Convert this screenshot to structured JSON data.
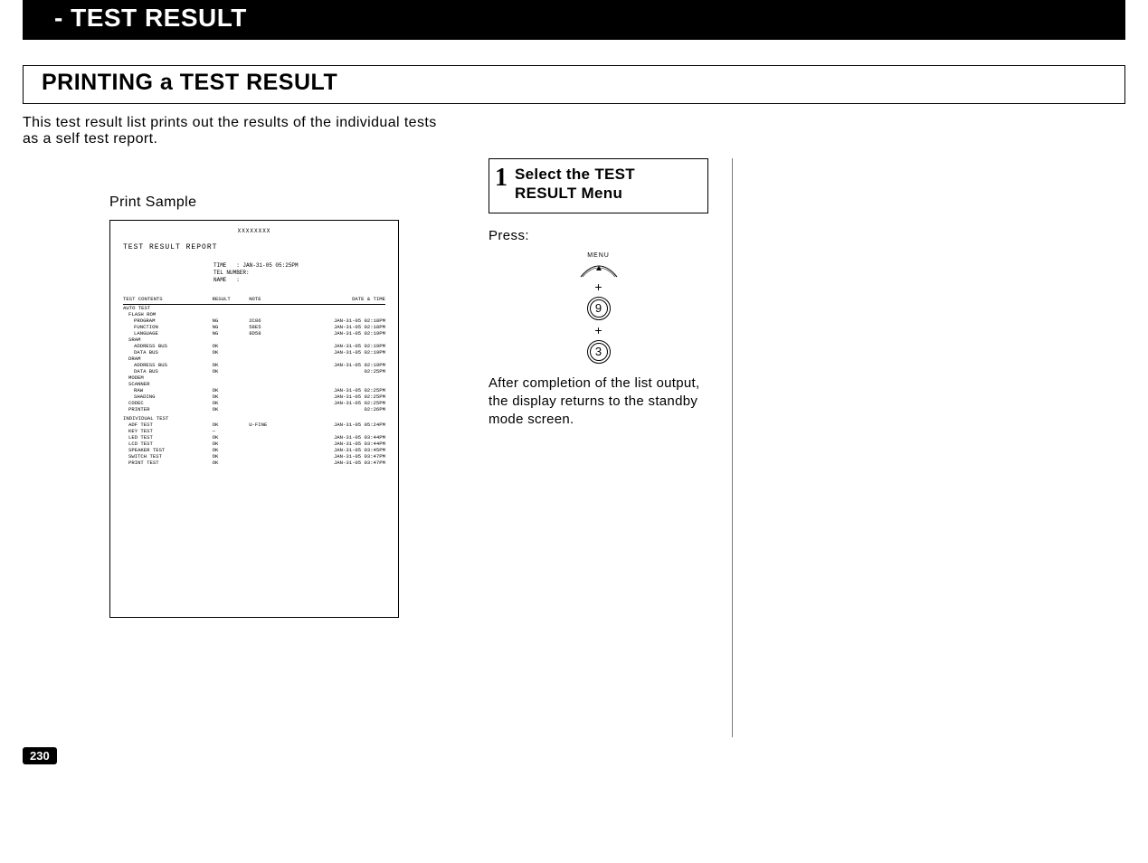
{
  "banner": "- TEST RESULT",
  "section_title": "PRINTING a TEST RESULT",
  "intro": "This test result list prints out the results of the individual tests as a self test report.",
  "print_sample_label": "Print Sample",
  "sheet": {
    "header_mark": "XXXXXXXX",
    "title": "TEST RESULT REPORT",
    "meta_time_label": "TIME",
    "meta_time_value": ": JAN-31-05  05:25PM",
    "meta_tel_label": "TEL NUMBER:",
    "meta_name_label": "NAME",
    "meta_name_value": ":",
    "col1": "TEST CONTENTS",
    "col2": "RESULT",
    "col3": "NOTE",
    "col4": "DATE & TIME",
    "groups": [
      {
        "label": "AUTO TEST",
        "indent": 0,
        "result": "",
        "note": "",
        "dt": ""
      },
      {
        "label": "FLASH ROM",
        "indent": 1,
        "result": "",
        "note": "",
        "dt": ""
      },
      {
        "label": "PROGRAM",
        "indent": 2,
        "result": "NG",
        "note": "2C86",
        "dt": "JAN-31-05 02:18PM"
      },
      {
        "label": "FUNCTION",
        "indent": 2,
        "result": "NG",
        "note": "58E5",
        "dt": "JAN-31-05 02:18PM"
      },
      {
        "label": "LANGUAGE",
        "indent": 2,
        "result": "NG",
        "note": "8D58",
        "dt": "JAN-31-05 02:19PM"
      },
      {
        "label": "SRAM",
        "indent": 1,
        "result": "",
        "note": "",
        "dt": ""
      },
      {
        "label": "ADDRESS BUS",
        "indent": 2,
        "result": "OK",
        "note": "",
        "dt": "JAN-31-05 02:19PM"
      },
      {
        "label": "DATA BUS",
        "indent": 2,
        "result": "OK",
        "note": "",
        "dt": "JAN-31-05 02:19PM"
      },
      {
        "label": "DRAM",
        "indent": 1,
        "result": "",
        "note": "",
        "dt": ""
      },
      {
        "label": "ADDRESS BUS",
        "indent": 2,
        "result": "OK",
        "note": "",
        "dt": "JAN-31-05 02:19PM"
      },
      {
        "label": "DATA BUS",
        "indent": 2,
        "result": "OK",
        "note": "",
        "dt": "02:25PM"
      },
      {
        "label": "MODEM",
        "indent": 1,
        "result": "",
        "note": "",
        "dt": ""
      },
      {
        "label": "SCANNER",
        "indent": 1,
        "result": "",
        "note": "",
        "dt": ""
      },
      {
        "label": "RAW",
        "indent": 2,
        "result": "OK",
        "note": "",
        "dt": "JAN-31-05 02:25PM"
      },
      {
        "label": "SHADING",
        "indent": 2,
        "result": "OK",
        "note": "",
        "dt": "JAN-31-05 02:25PM"
      },
      {
        "label": "CODEC",
        "indent": 1,
        "result": "OK",
        "note": "",
        "dt": "JAN-31-05 02:25PM"
      },
      {
        "label": "PRINTER",
        "indent": 1,
        "result": "OK",
        "note": "",
        "dt": "02:26PM"
      },
      {
        "label": "INDIVIDUAL TEST",
        "indent": 0,
        "result": "",
        "note": "",
        "dt": "",
        "spacer": true
      },
      {
        "label": "ADF TEST",
        "indent": 1,
        "result": "OK",
        "note": "U-FINE",
        "dt": "JAN-31-05 05:24PM"
      },
      {
        "label": "KEY TEST",
        "indent": 1,
        "result": "—",
        "note": "",
        "dt": ""
      },
      {
        "label": "LED TEST",
        "indent": 1,
        "result": "OK",
        "note": "",
        "dt": "JAN-31-05 03:44PM"
      },
      {
        "label": "LCD TEST",
        "indent": 1,
        "result": "OK",
        "note": "",
        "dt": "JAN-31-05 03:44PM"
      },
      {
        "label": "SPEAKER TEST",
        "indent": 1,
        "result": "OK",
        "note": "",
        "dt": "JAN-31-05 03:45PM"
      },
      {
        "label": "SWITCH TEST",
        "indent": 1,
        "result": "OK",
        "note": "",
        "dt": "JAN-31-05 03:47PM"
      },
      {
        "label": "PRINT TEST",
        "indent": 1,
        "result": "OK",
        "note": "",
        "dt": "JAN-31-05 03:47PM"
      }
    ]
  },
  "step": {
    "num": "1",
    "title": "Select the TEST RESULT Menu"
  },
  "press_label": "Press:",
  "keys": {
    "menu": "MENU",
    "k1": "9",
    "k2": "3",
    "plus": "+"
  },
  "after_text": "After completion of the list output, the display returns to the standby mode screen.",
  "page_number": "230"
}
